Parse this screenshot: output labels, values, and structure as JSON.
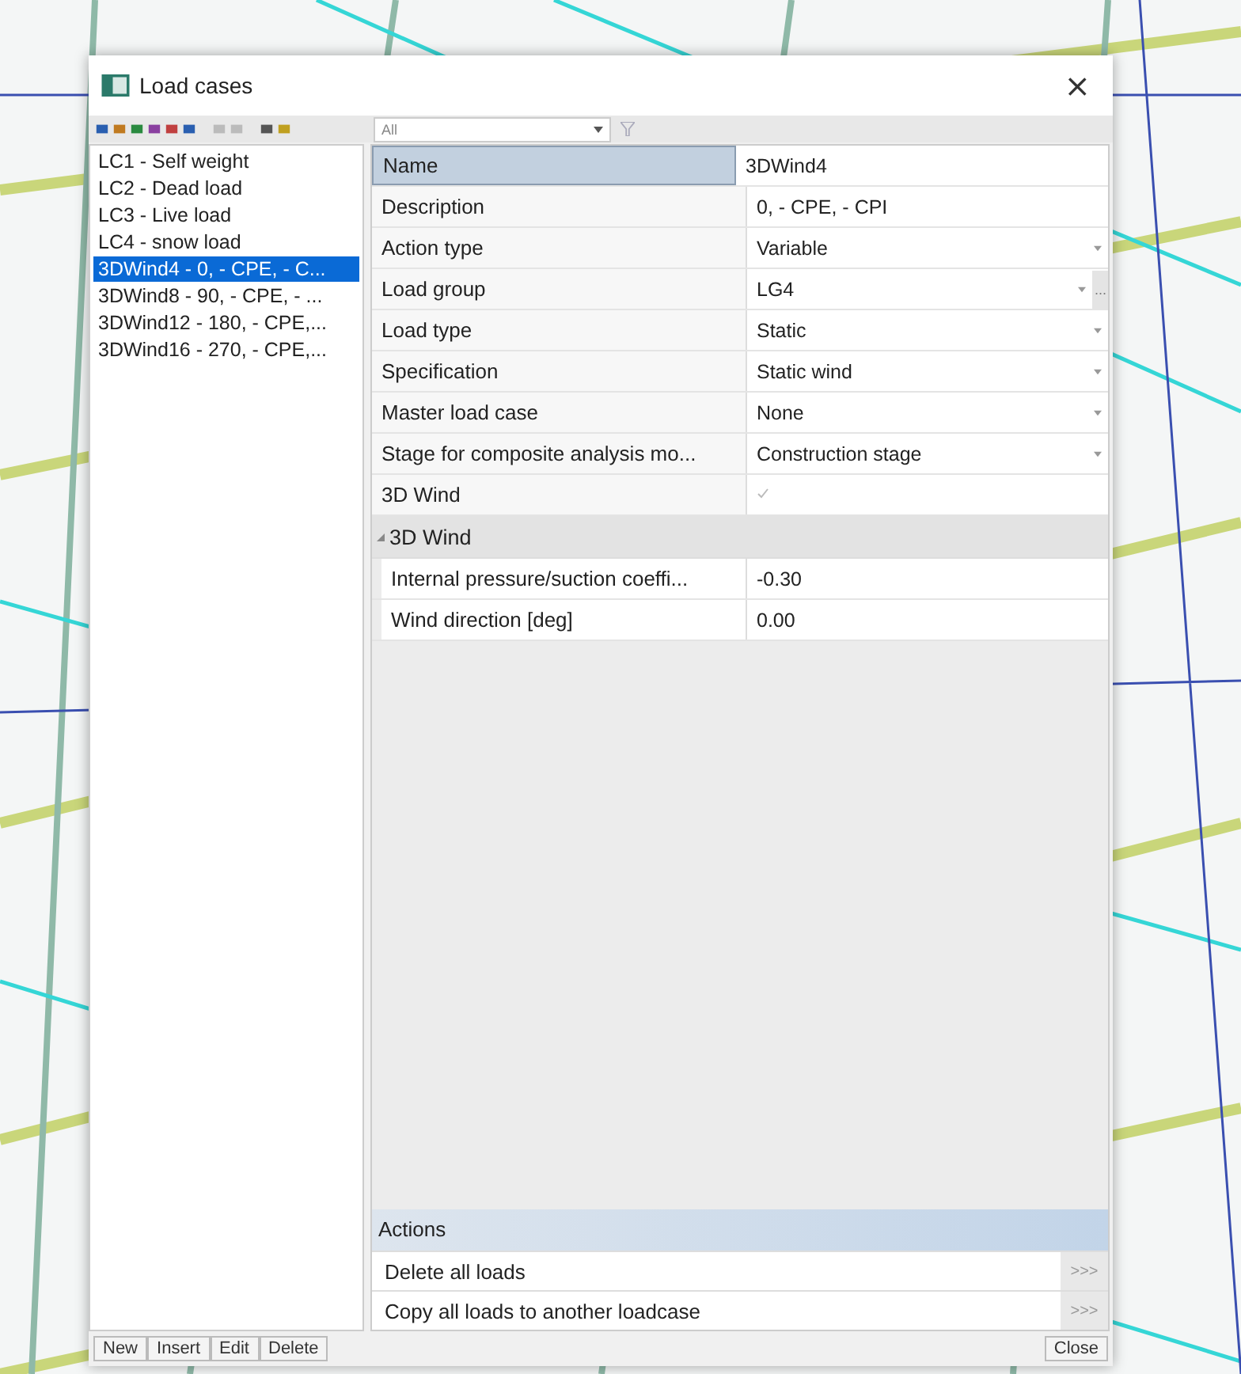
{
  "window": {
    "title": "Load cases",
    "close": "×"
  },
  "toolbar": {
    "filter": "All"
  },
  "load_cases": [
    {
      "label": "LC1 - Self weight",
      "selected": false
    },
    {
      "label": "LC2 - Dead load",
      "selected": false
    },
    {
      "label": "LC3 - Live load",
      "selected": false
    },
    {
      "label": "LC4 - snow load",
      "selected": false
    },
    {
      "label": "3DWind4 - 0, - CPE, - C...",
      "selected": true
    },
    {
      "label": "3DWind8 - 90, - CPE, - ...",
      "selected": false
    },
    {
      "label": "3DWind12 - 180, - CPE,...",
      "selected": false
    },
    {
      "label": "3DWind16 - 270, - CPE,...",
      "selected": false
    }
  ],
  "properties": [
    {
      "label": "Name",
      "value": "3DWind4",
      "kind": "text",
      "selected": true
    },
    {
      "label": "Description",
      "value": "0, - CPE, - CPI",
      "kind": "text",
      "selected": false
    },
    {
      "label": "Action type",
      "value": "Variable",
      "kind": "dropdown",
      "selected": false
    },
    {
      "label": "Load group",
      "value": "LG4",
      "kind": "dropdown-more",
      "more": "...",
      "selected": false
    },
    {
      "label": "Load type",
      "value": "Static",
      "kind": "dropdown",
      "selected": false
    },
    {
      "label": "Specification",
      "value": "Static wind",
      "kind": "dropdown",
      "selected": false
    },
    {
      "label": "Master load case",
      "value": "None",
      "kind": "dropdown",
      "selected": false
    },
    {
      "label": "Stage for composite analysis mo...",
      "value": "Construction stage",
      "kind": "dropdown",
      "selected": false
    },
    {
      "label": "3D Wind",
      "kind": "checkbox",
      "checked": true,
      "disabled": true,
      "selected": false
    }
  ],
  "group": {
    "label": "3D Wind",
    "expanded": true,
    "children": [
      {
        "label": "Internal pressure/suction coeffi...",
        "value": "-0.30"
      },
      {
        "label": "Wind direction [deg]",
        "value": "0.00"
      }
    ]
  },
  "actions": {
    "title": "Actions",
    "items": [
      {
        "label": "Delete all loads",
        "button": ">>>"
      },
      {
        "label": "Copy all loads to another loadcase",
        "button": ">>>"
      }
    ]
  },
  "buttons": [
    "New",
    "Insert",
    "Edit",
    "Delete"
  ],
  "close_button": "Close"
}
